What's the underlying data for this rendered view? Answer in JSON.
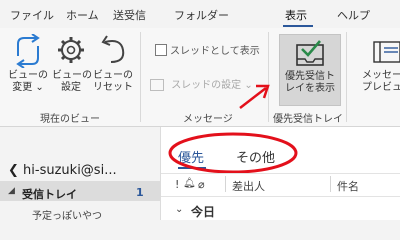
{
  "menu": {
    "tabs": [
      "ファイル",
      "ホーム",
      "送受信",
      "フォルダー",
      "表示",
      "ヘルプ"
    ],
    "active_tab": "表示"
  },
  "ribbon": {
    "current_view": {
      "change_view": "ビューの\n変更 ⌄",
      "view_settings": "ビューの\n設定",
      "reset_view": "ビューの\nリセット",
      "group_label": "現在のビュー"
    },
    "messages": {
      "show_as_conversations": "スレッドとして表示",
      "thread_settings": "スレッドの設定",
      "group_label": "メッセージ"
    },
    "focused_inbox": {
      "button_label": "優先受信ト\nレイを表示",
      "group_label": "優先受信トレイ"
    },
    "message_preview": {
      "button_label": "メッセージ\nプレビュー"
    }
  },
  "folders": {
    "account": "hi-suzuki@si...",
    "inbox_label": "受信トレイ",
    "inbox_count": "1",
    "subfolder": "予定っぽいやつ"
  },
  "message_list": {
    "tabs": [
      "優先",
      "その他"
    ],
    "col_sender": "差出人",
    "col_subject": "件名",
    "group_today": "今日"
  },
  "colors": {
    "accent": "#2b579a",
    "annotation_red": "#e3101b"
  }
}
